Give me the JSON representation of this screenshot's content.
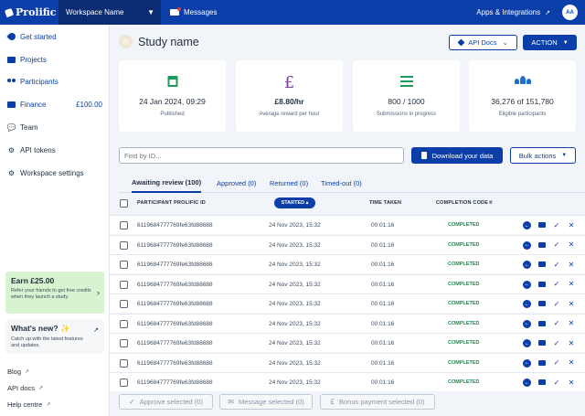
{
  "topbar": {
    "logo": "Prolific",
    "workspace": "Workspace Name",
    "messages": "Messages",
    "apps": "Apps & Integrations",
    "avatar": "AA"
  },
  "sidebar": {
    "items": [
      {
        "label": "Get started",
        "icon": "rocket-icon"
      },
      {
        "label": "Projects",
        "icon": "folder-icon"
      },
      {
        "label": "Participants",
        "icon": "people-icon"
      },
      {
        "label": "Finance",
        "icon": "folder-icon",
        "amount": "£100.00"
      },
      {
        "label": "Team",
        "icon": "comment-icon"
      },
      {
        "label": "API tokens",
        "icon": "gear-icon"
      },
      {
        "label": "Workspace settings",
        "icon": "gear-icon"
      }
    ],
    "earn": {
      "title": "Earn £25.00",
      "desc": "Refer your friends to get free credits when they launch a study."
    },
    "whats_new": {
      "title": "What's new? ✨",
      "desc": "Catch up with the latest features and updates."
    },
    "links": [
      "Blog",
      "API docs",
      "Help centre"
    ]
  },
  "header": {
    "study_name": "Study name",
    "api_docs": "API Docs",
    "action": "ACTION"
  },
  "cards": [
    {
      "value": "24 Jan 2024, 09:29",
      "label": "Published",
      "icon": "calendar-icon"
    },
    {
      "value": "£8.80/hr",
      "label": "Average reward per hour",
      "icon": "pound-icon"
    },
    {
      "value": "800 / 1000",
      "label": "Submissions in progress",
      "icon": "list-icon"
    },
    {
      "value": "36,276 of 151,780",
      "label": "Eligible participants",
      "icon": "group-icon"
    }
  ],
  "toolbar": {
    "search_placeholder": "Find by ID...",
    "download": "Download your data",
    "bulk": "Bulk actions"
  },
  "tabs": [
    "Awaiting review (100)",
    "Approved (0)",
    "Returned (0)",
    "Timed-out (0)"
  ],
  "table": {
    "headers": {
      "id": "PARTICIPANT PROLIFIC ID",
      "started": "STARTED",
      "time": "TIME TAKEN",
      "code": "COMPLETION CODE"
    },
    "rows": [
      {
        "id": "6119684777769fe63fd88688",
        "started": "24 Nov 2023, 15:32",
        "time": "00:01:16",
        "code": "COMPLETED"
      },
      {
        "id": "6119684777769fe63fd88688",
        "started": "24 Nov 2023, 15:32",
        "time": "00:01:16",
        "code": "COMPLETED"
      },
      {
        "id": "6119684777769fe63fd88688",
        "started": "24 Nov 2023, 15:32",
        "time": "00:01:16",
        "code": "COMPLETED"
      },
      {
        "id": "6119684777769fe63fd88688",
        "started": "24 Nov 2023, 15:32",
        "time": "00:01:16",
        "code": "COMPLETED"
      },
      {
        "id": "6119684777769fe63fd88688",
        "started": "24 Nov 2023, 15:32",
        "time": "00:01:16",
        "code": "COMPLETED"
      },
      {
        "id": "6119684777769fe63fd88688",
        "started": "24 Nov 2023, 15:32",
        "time": "00:01:16",
        "code": "COMPLETED"
      },
      {
        "id": "6119684777769fe63fd88688",
        "started": "24 Nov 2023, 15:32",
        "time": "00:01:16",
        "code": "COMPLETED"
      },
      {
        "id": "6119684777769fe63fd88688",
        "started": "24 Nov 2023, 15:32",
        "time": "00:01:16",
        "code": "COMPLETED"
      },
      {
        "id": "6119684777769fe63fd88688",
        "started": "24 Nov 2023, 15:32",
        "time": "00:01:16",
        "code": "COMPLETED"
      }
    ]
  },
  "footer_actions": {
    "approve": "Approve selected (0)",
    "message": "Message selected (0)",
    "bonus": "Bonus payment selected (0)"
  },
  "colors": {
    "brand": "#0b3ea8",
    "status": "#1a8a4a",
    "earn_bg": "#d8f3d0"
  }
}
